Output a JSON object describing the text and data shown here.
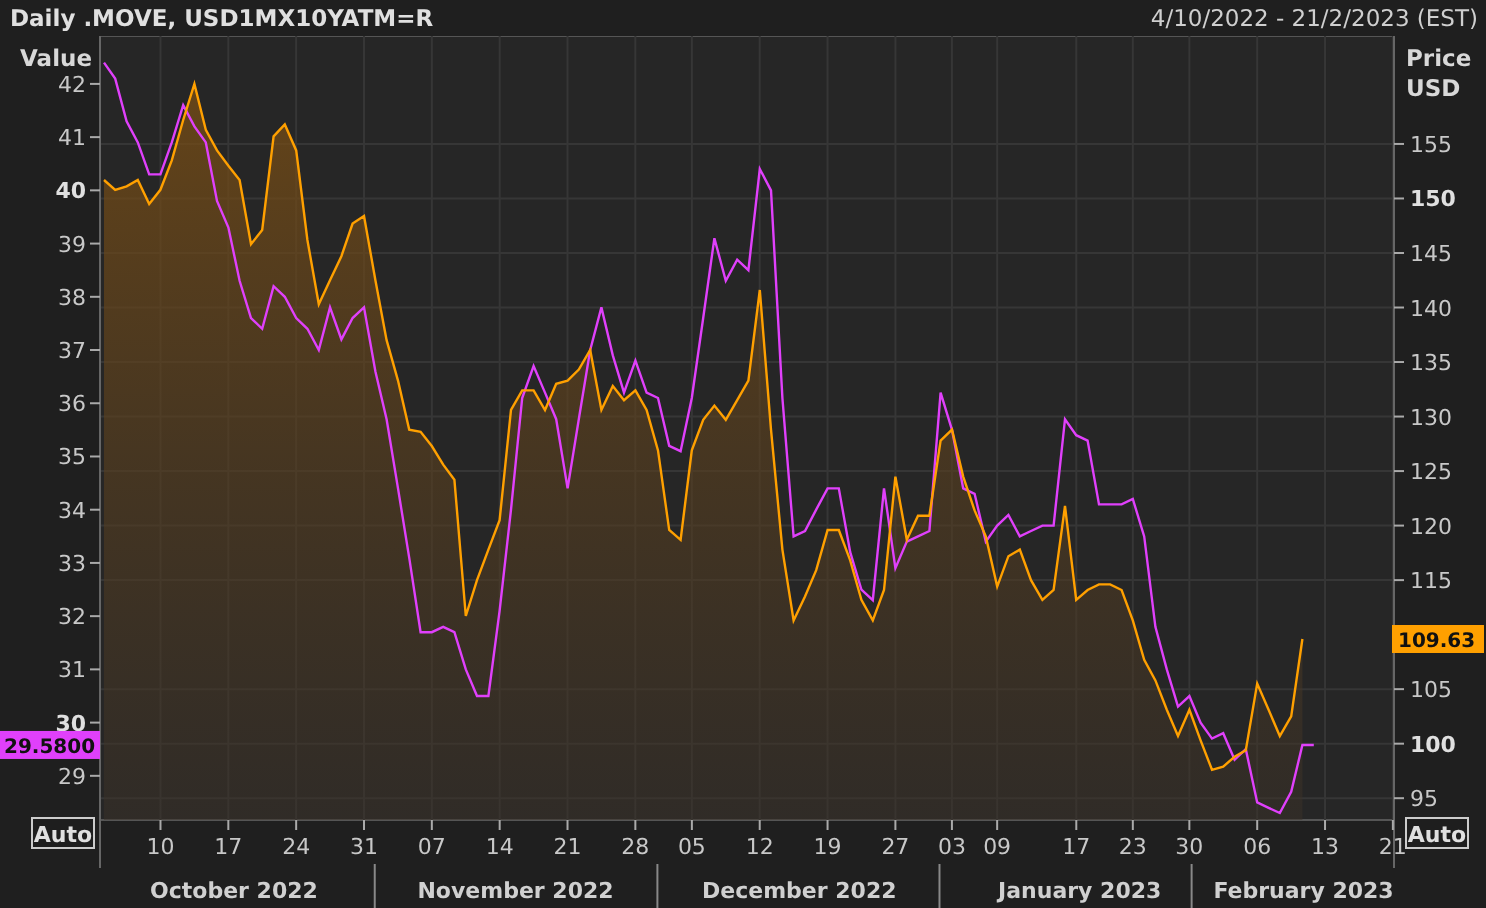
{
  "header": {
    "title": "Daily .MOVE, USD1MX10YATM=R",
    "date_range": "4/10/2022 - 21/2/2023 (EST)"
  },
  "chart": {
    "left_axis_title": "Value",
    "right_axis_title": [
      "Price",
      "USD"
    ],
    "auto_buttons": [
      "Auto",
      "Auto"
    ],
    "last_values": [
      {
        "text": "29.5800",
        "color": "#e040fb"
      },
      {
        "text": "109.63",
        "color": "#ffa000"
      }
    ],
    "chart_data": {
      "type": "line",
      "categories": [
        null,
        null,
        null,
        null,
        null,
        "10",
        null,
        null,
        null,
        null,
        null,
        "17",
        null,
        null,
        null,
        null,
        null,
        "24",
        null,
        null,
        null,
        null,
        null,
        "31",
        null,
        null,
        null,
        null,
        null,
        "07",
        null,
        null,
        null,
        null,
        null,
        "14",
        null,
        null,
        null,
        null,
        null,
        "21",
        null,
        null,
        null,
        null,
        null,
        "28",
        null,
        null,
        null,
        null,
        "05",
        null,
        null,
        null,
        null,
        null,
        "12",
        null,
        null,
        null,
        null,
        null,
        "19",
        null,
        null,
        null,
        null,
        null,
        "27",
        null,
        null,
        null,
        null,
        "03",
        null,
        null,
        null,
        "09",
        null,
        null,
        null,
        null,
        null,
        null,
        "17",
        null,
        null,
        null,
        null,
        "23",
        null,
        null,
        null,
        null,
        "30",
        null,
        null,
        null,
        null,
        null,
        "06",
        null,
        null,
        null,
        null,
        null,
        "13",
        null,
        null,
        null,
        null,
        null,
        "21"
      ],
      "series": [
        {
          "color": "#e040fb",
          "type": "line",
          "values": [
            42.4,
            42.1,
            41.3,
            40.9,
            40.3,
            40.3,
            40.9,
            41.6,
            41.2,
            40.9,
            39.8,
            39.3,
            38.3,
            37.6,
            37.4,
            38.2,
            38.0,
            37.6,
            37.4,
            37.0,
            37.8,
            37.2,
            37.6,
            37.8,
            36.6,
            35.7,
            34.4,
            33.1,
            31.7,
            31.7,
            31.8,
            31.7,
            31.0,
            30.5,
            30.5,
            32.1,
            34.0,
            36.1,
            36.7,
            36.2,
            35.7,
            34.4,
            35.7,
            37.0,
            37.8,
            36.9,
            36.2,
            36.8,
            36.2,
            36.1,
            35.2,
            35.1,
            36.1,
            37.6,
            39.1,
            38.3,
            38.7,
            38.5,
            40.4,
            40.0,
            36.1,
            33.5,
            33.6,
            34.0,
            34.4,
            34.4,
            33.2,
            32.5,
            32.3,
            34.4,
            32.9,
            33.4,
            33.5,
            33.6,
            36.2,
            35.5,
            34.4,
            34.3,
            33.4,
            33.7,
            33.9,
            33.5,
            33.6,
            33.7,
            33.7,
            35.7,
            35.4,
            35.3,
            34.1,
            34.1,
            34.1,
            34.2,
            33.5,
            31.8,
            31.0,
            30.3,
            30.5,
            30.0,
            29.7,
            29.8,
            29.3,
            29.5,
            28.5,
            28.4,
            28.3,
            28.7,
            29.58,
            29.58,
            null,
            null,
            null,
            null,
            null,
            null,
            null
          ]
        },
        {
          "color": "#ffa000",
          "axis": "y2",
          "type": "area",
          "values": [
            151.7,
            150.8,
            151.1,
            151.7,
            149.5,
            150.8,
            153.5,
            157.2,
            160.5,
            156.3,
            154.4,
            153.0,
            151.7,
            145.8,
            147.1,
            155.7,
            156.8,
            154.4,
            146.2,
            140.3,
            142.5,
            144.7,
            147.7,
            148.4,
            142.5,
            137.0,
            133.3,
            128.8,
            128.6,
            127.3,
            125.6,
            124.2,
            111.7,
            115.0,
            117.8,
            120.5,
            130.6,
            132.4,
            132.4,
            130.6,
            133.0,
            133.3,
            134.3,
            136.1,
            130.6,
            132.8,
            131.5,
            132.4,
            130.6,
            126.9,
            119.6,
            118.7,
            126.9,
            129.7,
            131.0,
            129.7,
            131.5,
            133.3,
            141.6,
            128.8,
            117.8,
            111.3,
            113.5,
            115.9,
            119.6,
            119.6,
            116.8,
            113.2,
            111.3,
            114.1,
            124.5,
            118.7,
            120.9,
            120.9,
            127.8,
            128.8,
            124.5,
            121.4,
            119.0,
            114.4,
            117.2,
            117.8,
            115.0,
            113.2,
            114.1,
            121.8,
            113.2,
            114.1,
            114.6,
            114.6,
            114.1,
            111.3,
            107.7,
            105.8,
            103.1,
            100.7,
            103.1,
            100.3,
            97.6,
            97.9,
            98.8,
            99.4,
            105.5,
            103.1,
            100.7,
            102.5,
            109.6,
            null,
            null,
            null,
            null,
            null,
            null,
            null,
            null
          ]
        }
      ],
      "grid": true,
      "annotations": [
        "October 2022",
        "November 2022",
        "December 2022",
        "January 2023",
        "February 2023"
      ],
      "ylim": [
        28.17,
        42.9
      ],
      "yticks": [
        29,
        30,
        31,
        32,
        33,
        34,
        35,
        36,
        37,
        38,
        39,
        40,
        41,
        42
      ],
      "y2lim": [
        93.0,
        164.9
      ],
      "y2ticks": [
        95,
        100,
        105,
        115,
        120,
        125,
        130,
        135,
        140,
        145,
        150,
        155
      ]
    }
  }
}
